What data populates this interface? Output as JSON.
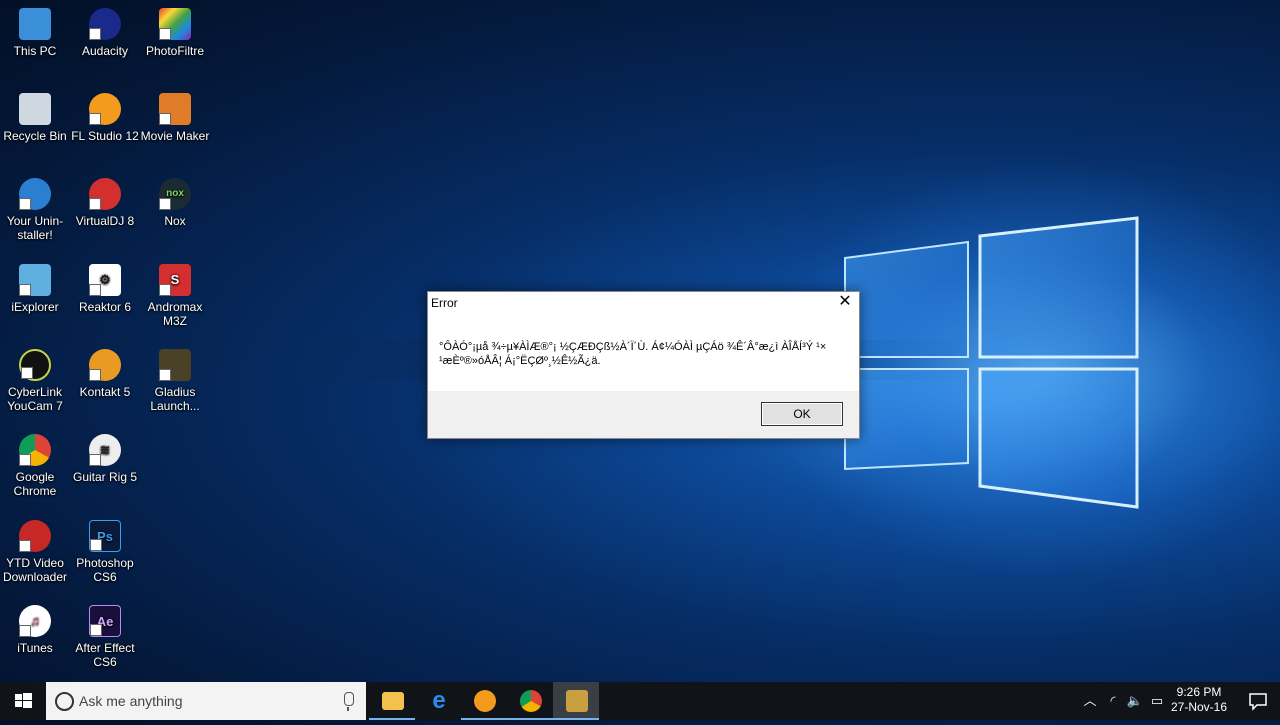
{
  "desktop": {
    "icons": [
      {
        "label": "This PC"
      },
      {
        "label": "Recycle Bin"
      },
      {
        "label": "Your Unin-staller!"
      },
      {
        "label": "iExplorer"
      },
      {
        "label": "CyberLink YouCam 7"
      },
      {
        "label": "Google Chrome"
      },
      {
        "label": "YTD Video Downloader"
      },
      {
        "label": "iTunes"
      },
      {
        "label": "Audacity"
      },
      {
        "label": "FL Studio 12"
      },
      {
        "label": "VirtualDJ 8"
      },
      {
        "label": "Reaktor 6"
      },
      {
        "label": "Kontakt 5"
      },
      {
        "label": "Guitar Rig 5"
      },
      {
        "label": "Photoshop CS6"
      },
      {
        "label": "After Effect CS6"
      },
      {
        "label": "PhotoFiltre"
      },
      {
        "label": "Movie Maker"
      },
      {
        "label": "Nox"
      },
      {
        "label": "Andromax M3Z"
      },
      {
        "label": "Gladius Launch..."
      }
    ]
  },
  "dialog": {
    "title": "Error",
    "message": "°ÔÀÓ°¡µå ¾÷µ¥ÀÌÆ®°¡ ½ÇÆÐÇß½À´Ï´Ù. Á¢¼ÓÀÌ µÇÁö ¾Ê´Â°æ¿ì ÀÎÅÍ³Ý ¹× ¹æÈ­º®»óÅÂ¦ Á¡°ËÇØº¸½Ê½Ã¿ä.",
    "ok_label": "OK"
  },
  "taskbar": {
    "search_placeholder": "Ask me anything",
    "time": "9:26 PM",
    "date": "27-Nov-16"
  },
  "colors": {
    "taskbar_bg": "#101418",
    "dialog_footer": "#f0f0f0",
    "accent": "#7ab2e8"
  }
}
